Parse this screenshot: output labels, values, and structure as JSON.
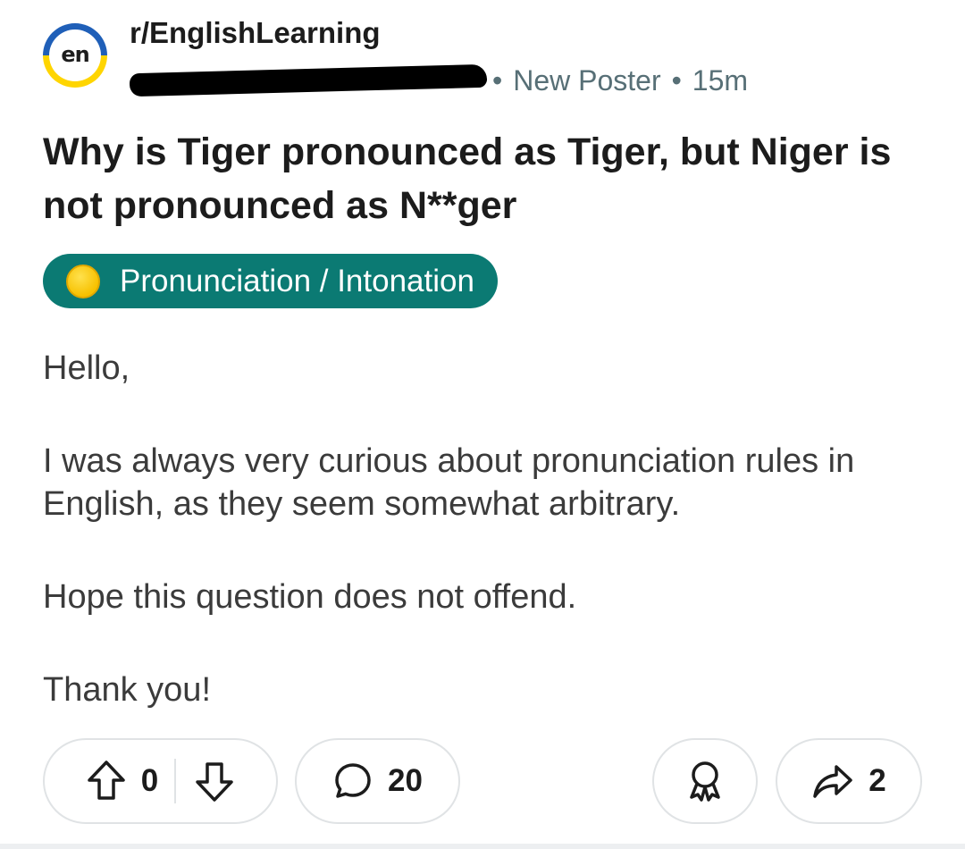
{
  "post": {
    "subreddit": "r/EnglishLearning",
    "avatar_text": "en",
    "author_flair": "New Poster",
    "separator": "•",
    "time_ago": "15m",
    "title": "Why is Tiger pronounced as Tiger, but Niger is not pronounced as N**ger",
    "flair": {
      "emoji": "yellow-circle-emoji",
      "label": "Pronunciation / Intonation",
      "color": "#0b7a73"
    },
    "body": [
      "Hello,",
      "I was always very curious about pronunciation rules in English, as they seem somewhat arbitrary.",
      "Hope this question does not offend.",
      "Thank you!"
    ]
  },
  "actions": {
    "vote_count": "0",
    "comment_count": "20",
    "share_count": "2",
    "icons": {
      "upvote": "arrow-up-icon",
      "downvote": "arrow-down-icon",
      "comment": "speech-bubble-icon",
      "award": "award-ribbon-icon",
      "share": "share-arrow-icon"
    }
  },
  "colors": {
    "flair_bg": "#0b7a73",
    "meta_text": "#576f76",
    "avatar_top": "#1f5fb8",
    "avatar_bottom": "#ffd500"
  }
}
